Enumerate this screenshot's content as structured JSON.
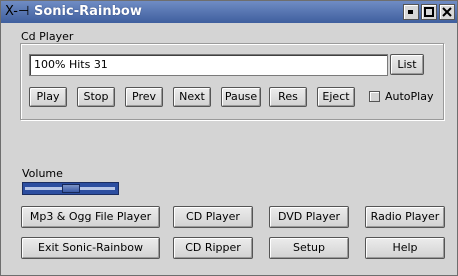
{
  "window": {
    "title": "Sonic-Rainbow",
    "wm_icon": "X-⊣"
  },
  "cd_player": {
    "group_label": "Cd Player",
    "track_value": "100% Hits 31",
    "list_label": "List",
    "controls": [
      "Play",
      "Stop",
      "Prev",
      "Next",
      "Pause",
      "Res",
      "Eject"
    ],
    "autoplay_label": "AutoPlay",
    "autoplay_checked": false
  },
  "volume": {
    "label": "Volume",
    "level": 0.5
  },
  "bottom_buttons": {
    "row1": [
      "Mp3 & Ogg File Player",
      "CD Player",
      "DVD Player",
      "Radio Player"
    ],
    "row2": [
      "Exit Sonic-Rainbow",
      "CD Ripper",
      "Setup",
      "Help"
    ]
  },
  "colors": {
    "title_bar": "#3f5f9e",
    "slider": "#2c4ea0"
  }
}
